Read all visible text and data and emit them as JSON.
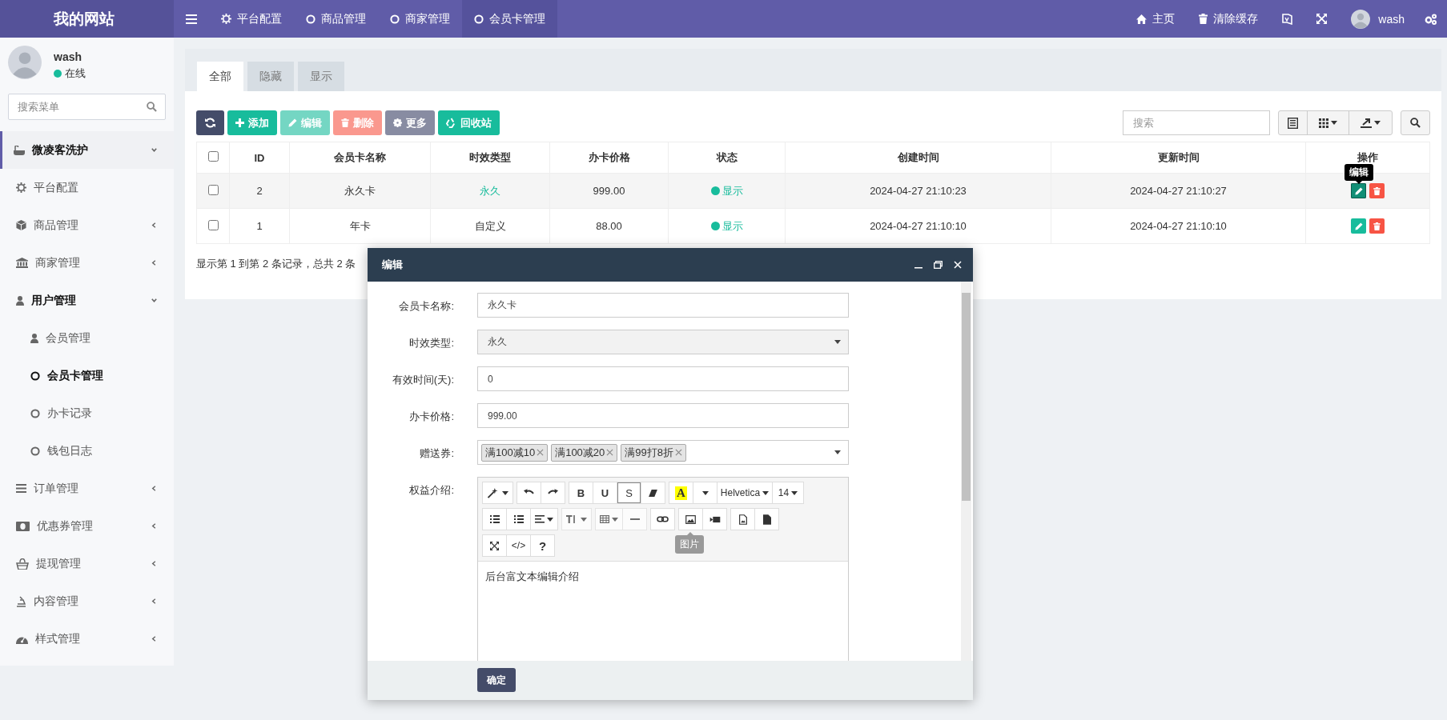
{
  "topbar": {
    "logo": "我的网站",
    "nav": [
      {
        "label": "平台配置",
        "selected": false
      },
      {
        "label": "商品管理",
        "selected": false
      },
      {
        "label": "商家管理",
        "selected": false
      },
      {
        "label": "会员卡管理",
        "selected": true
      }
    ],
    "links": [
      {
        "label": "主页"
      },
      {
        "label": "清除缓存"
      }
    ],
    "user": "wash"
  },
  "sidebar": {
    "user": {
      "name": "wash",
      "status": {
        "label": "在线",
        "color": "#18bc9c"
      }
    },
    "search": {
      "placeholder": "搜索菜单"
    },
    "items": [
      {
        "label": "微凌客洗护",
        "expanded": true,
        "selected": false,
        "children": [
          {
            "label": "平台配置",
            "selected": false
          },
          {
            "label": "商品管理",
            "expanded": false,
            "selected": false
          },
          {
            "label": "商家管理",
            "expanded": false,
            "selected": false
          },
          {
            "label": "用户管理",
            "expanded": true,
            "selected": false,
            "children": [
              {
                "label": "会员管理",
                "selected": false
              },
              {
                "label": "会员卡管理",
                "selected": true
              },
              {
                "label": "办卡记录",
                "selected": false
              },
              {
                "label": "钱包日志",
                "selected": false
              }
            ]
          },
          {
            "label": "订单管理",
            "expanded": false,
            "selected": false
          },
          {
            "label": "优惠券管理",
            "expanded": false,
            "selected": false
          },
          {
            "label": "提现管理",
            "expanded": false,
            "selected": false
          },
          {
            "label": "内容管理",
            "expanded": false,
            "selected": false
          },
          {
            "label": "样式管理",
            "expanded": false,
            "selected": false
          }
        ]
      }
    ]
  },
  "tabs": [
    {
      "label": "全部",
      "selected": true
    },
    {
      "label": "隐藏",
      "selected": false
    },
    {
      "label": "显示",
      "selected": false
    }
  ],
  "toolbar": {
    "buttons": [
      {
        "label": "添加",
        "disabled": false
      },
      {
        "label": "编辑",
        "disabled": true
      },
      {
        "label": "删除",
        "disabled": true
      },
      {
        "label": "更多",
        "disabled": false
      },
      {
        "label": "回收站",
        "disabled": false
      }
    ],
    "search": {
      "placeholder": "搜索"
    }
  },
  "table": {
    "header_checked": false,
    "columns": [
      "ID",
      "会员卡名称",
      "时效类型",
      "办卡价格",
      "状态",
      "创建时间",
      "更新时间",
      "操作"
    ],
    "rows": [
      {
        "checked": false,
        "hovered": true,
        "id": "2",
        "name": "永久卡",
        "type": "永久",
        "type_highlighted": true,
        "price": "999.00",
        "status": {
          "label": "显示",
          "color": "#18bc9c"
        },
        "created": "2024-04-27 21:10:23",
        "updated": "2024-04-27 21:10:27",
        "edit_tooltip": "编辑"
      },
      {
        "checked": false,
        "hovered": false,
        "id": "1",
        "name": "年卡",
        "type": "自定义",
        "type_highlighted": false,
        "price": "88.00",
        "status": {
          "label": "显示",
          "color": "#18bc9c"
        },
        "created": "2024-04-27 21:10:10",
        "updated": "2024-04-27 21:10:10"
      }
    ]
  },
  "pagination": {
    "summary": "显示第 1 到第 2 条记录，总共 2 条"
  },
  "modal": {
    "title": "编辑",
    "fields": [
      {
        "kind": "text",
        "label": "会员卡名称:",
        "value": "永久卡"
      },
      {
        "kind": "select",
        "label": "时效类型:",
        "value": "永久"
      },
      {
        "kind": "text",
        "label": "有效时间(天):",
        "value": "0"
      },
      {
        "kind": "text",
        "label": "办卡价格:",
        "value": "999.00"
      },
      {
        "kind": "tags",
        "label": "赠送券:",
        "tags": [
          "满100减10",
          "满100减20",
          "满99打8折"
        ]
      },
      {
        "kind": "editor",
        "label": "权益介绍:",
        "content": "后台富文本编辑介绍"
      }
    ],
    "editor": {
      "format": [
        {
          "label": "B",
          "active": false
        },
        {
          "label": "U",
          "active": false
        },
        {
          "label": "S",
          "active": true
        }
      ],
      "color_label": "A",
      "font": "Helvetica",
      "size": "14",
      "code": "</>",
      "help": "?",
      "tooltip": "图片"
    },
    "submit": "确定"
  }
}
